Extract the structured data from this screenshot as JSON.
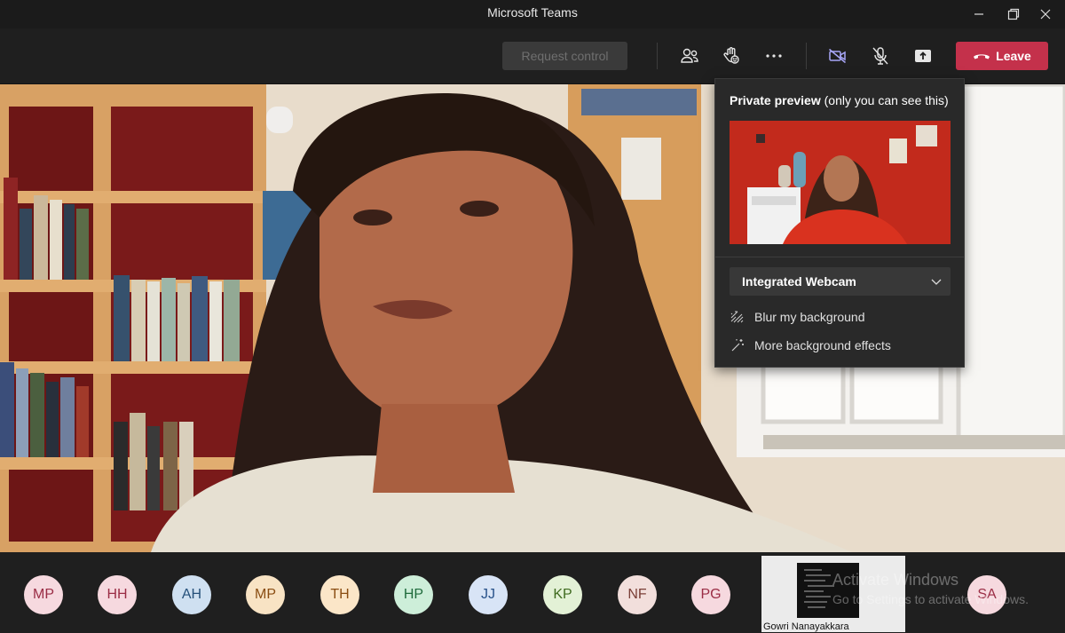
{
  "window": {
    "title": "Microsoft Teams"
  },
  "toolbar": {
    "request_control_label": "Request control",
    "leave_label": "Leave"
  },
  "preview": {
    "title_bold": "Private preview",
    "title_rest": " (only you can see this)",
    "camera_selected": "Integrated Webcam",
    "options": [
      "Blur my background",
      "More background effects"
    ]
  },
  "participants": [
    {
      "initials": "MP",
      "bg": "#f6d9df",
      "fg": "#9a2d45"
    },
    {
      "initials": "HH",
      "bg": "#f6d9df",
      "fg": "#9a2d45"
    },
    {
      "initials": "AH",
      "bg": "#cfe0f1",
      "fg": "#25507a"
    },
    {
      "initials": "MP",
      "bg": "#f8e3c4",
      "fg": "#8a4d12"
    },
    {
      "initials": "TH",
      "bg": "#fbe6c8",
      "fg": "#8a4d12"
    },
    {
      "initials": "HP",
      "bg": "#cdeed9",
      "fg": "#1f6b3c"
    },
    {
      "initials": "JJ",
      "bg": "#d8e4f6",
      "fg": "#28528a"
    },
    {
      "initials": "KP",
      "bg": "#e3f1d6",
      "fg": "#3f6a1f"
    },
    {
      "initials": "NF",
      "bg": "#f2dfdc",
      "fg": "#7a3f37"
    },
    {
      "initials": "PG",
      "bg": "#f6d9df",
      "fg": "#9a2d45"
    },
    {
      "initials": "SA",
      "bg": "#f6d9df",
      "fg": "#9a2d45"
    }
  ],
  "shared_tile": {
    "name": "Gowri Nanayakkara"
  },
  "watermark": {
    "line1": "Activate Windows",
    "line2": "Go to Settings to activate Windows."
  }
}
